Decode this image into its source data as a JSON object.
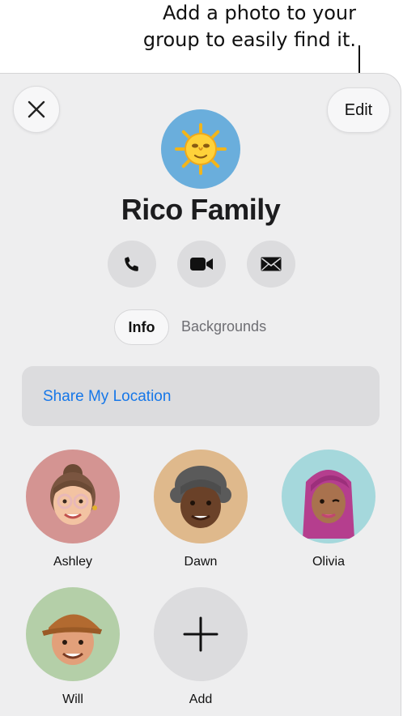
{
  "callout": {
    "line1": "Add a photo to your",
    "line2": "group to easily find it."
  },
  "header": {
    "close_icon": "close-icon",
    "edit_label": "Edit"
  },
  "group": {
    "name": "Rico Family",
    "photo_icon": "sun-face-icon",
    "photo_color": "#6aaedc"
  },
  "actions": [
    {
      "icon": "phone-icon"
    },
    {
      "icon": "video-icon"
    },
    {
      "icon": "mail-icon"
    }
  ],
  "tabs": {
    "info": "Info",
    "backgrounds": "Backgrounds"
  },
  "share_location": {
    "label": "Share My Location",
    "color": "#1677e8"
  },
  "members": [
    {
      "name": "Ashley",
      "color": "#d49492"
    },
    {
      "name": "Dawn",
      "color": "#dfb98c"
    },
    {
      "name": "Olivia",
      "color": "#a5d8dc"
    },
    {
      "name": "Will",
      "color": "#b4cfa8"
    }
  ],
  "add": {
    "label": "Add",
    "icon": "plus-icon"
  }
}
